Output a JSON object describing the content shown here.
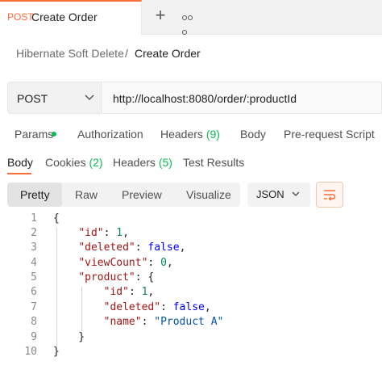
{
  "tab": {
    "method": "POST",
    "title": "Create Order",
    "plus_icon": "plus-icon",
    "more_icon": "more-icon"
  },
  "breadcrumb": {
    "parent": "Hibernate Soft Delete",
    "separator": "/",
    "current": "Create Order"
  },
  "request": {
    "method": "POST",
    "url": "http://localhost:8080/order/:productId"
  },
  "request_tabs": [
    {
      "label": "Params"
    },
    {
      "label": "Authorization"
    },
    {
      "label": "Headers",
      "count": "(9)"
    },
    {
      "label": "Body"
    },
    {
      "label": "Pre-request Script"
    }
  ],
  "response_tabs": [
    {
      "label": "Body"
    },
    {
      "label": "Cookies",
      "count": "(2)"
    },
    {
      "label": "Headers",
      "count": "(5)"
    },
    {
      "label": "Test Results"
    }
  ],
  "view_modes": [
    "Pretty",
    "Raw",
    "Preview",
    "Visualize"
  ],
  "active_view": "Pretty",
  "format": "JSON",
  "accent_color": "#ff6c37",
  "status_green": "#0cbb52",
  "code": {
    "line_numbers": [
      "1",
      "2",
      "3",
      "4",
      "5",
      "6",
      "7",
      "8",
      "9",
      "10"
    ],
    "open_brace": "{",
    "close_brace": "}",
    "id_key": "\"id\"",
    "id_val": "1",
    "deleted_key": "\"deleted\"",
    "deleted_val": "false",
    "viewcount_key": "\"viewCount\"",
    "viewcount_val": "0",
    "product_key": "\"product\"",
    "p_id_key": "\"id\"",
    "p_id_val": "1",
    "p_deleted_key": "\"deleted\"",
    "p_deleted_val": "false",
    "p_name_key": "\"name\"",
    "p_name_val": "\"Product A\""
  }
}
